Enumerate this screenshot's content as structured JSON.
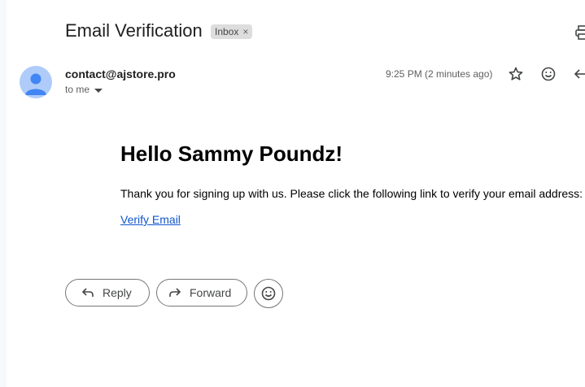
{
  "email": {
    "subject": "Email Verification",
    "label_chip": "Inbox",
    "label_remove": "×",
    "sender": "contact@ajstore.pro",
    "recipient": "to me",
    "time": "9:25 PM (2 minutes ago)"
  },
  "message": {
    "heading": "Hello Sammy Poundz!",
    "text": "Thank you for signing up with us. Please click the following link to verify your email address:",
    "link": "Verify Email"
  },
  "actions": {
    "reply": "Reply",
    "forward": "Forward"
  },
  "icons": {
    "print": "print-icon",
    "star": "star-icon",
    "emoji": "emoji-icon",
    "reply": "reply-icon",
    "forward": "forward-icon"
  },
  "colors": {
    "avatar_bg": "#aecbfa",
    "avatar_fg": "#4285f4",
    "link": "#1155cc"
  }
}
